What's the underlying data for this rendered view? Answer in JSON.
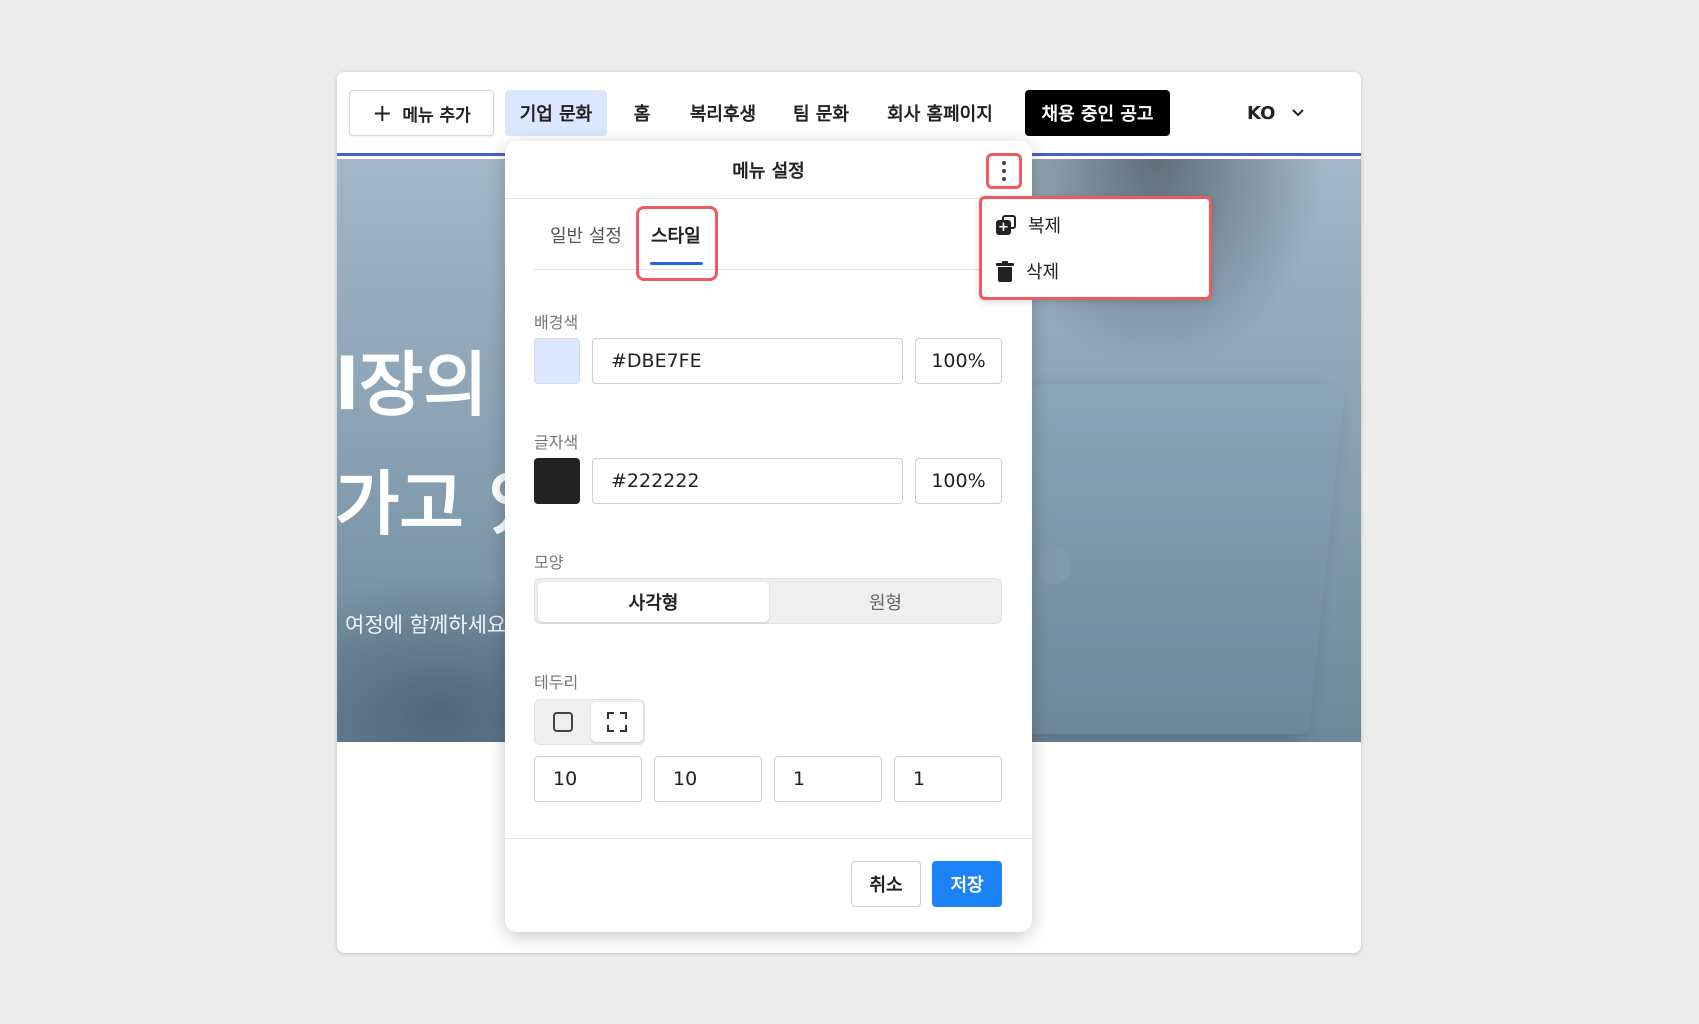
{
  "navbar": {
    "add_menu_label": "메뉴 추가",
    "items": [
      {
        "label": "기업 문화"
      },
      {
        "label": "홈"
      },
      {
        "label": "복리후생"
      },
      {
        "label": "팀 문화"
      },
      {
        "label": "회사 홈페이지"
      },
      {
        "label": "채용 중인 공고"
      }
    ],
    "language": "KO"
  },
  "hero": {
    "line1": "l장의",
    "line2": "가고 있",
    "subtitle": "여정에 함께하세요"
  },
  "panel": {
    "title": "메뉴 설정",
    "tabs": [
      {
        "label": "일반 설정"
      },
      {
        "label": "스타일"
      }
    ],
    "background_color": {
      "label": "배경색",
      "hex": "#DBE7FE",
      "opacity": "100%"
    },
    "text_color": {
      "label": "글자색",
      "hex": "#222222",
      "opacity": "100%"
    },
    "shape": {
      "label": "모양",
      "options": [
        {
          "label": "사각형",
          "selected": true
        },
        {
          "label": "원형",
          "selected": false
        }
      ]
    },
    "border": {
      "label": "테두리",
      "values": [
        "10",
        "10",
        "1",
        "1"
      ]
    },
    "cancel_label": "취소",
    "save_label": "저장"
  },
  "context_menu": {
    "items": [
      {
        "label": "복제",
        "icon": "duplicate-icon"
      },
      {
        "label": "삭제",
        "icon": "trash-icon"
      }
    ]
  },
  "colors": {
    "accent": "#1B82F8",
    "highlight": "#EE5A5E",
    "active_tab_bg": "#DBE7FE",
    "nav_underline": "#4B5FC8"
  }
}
